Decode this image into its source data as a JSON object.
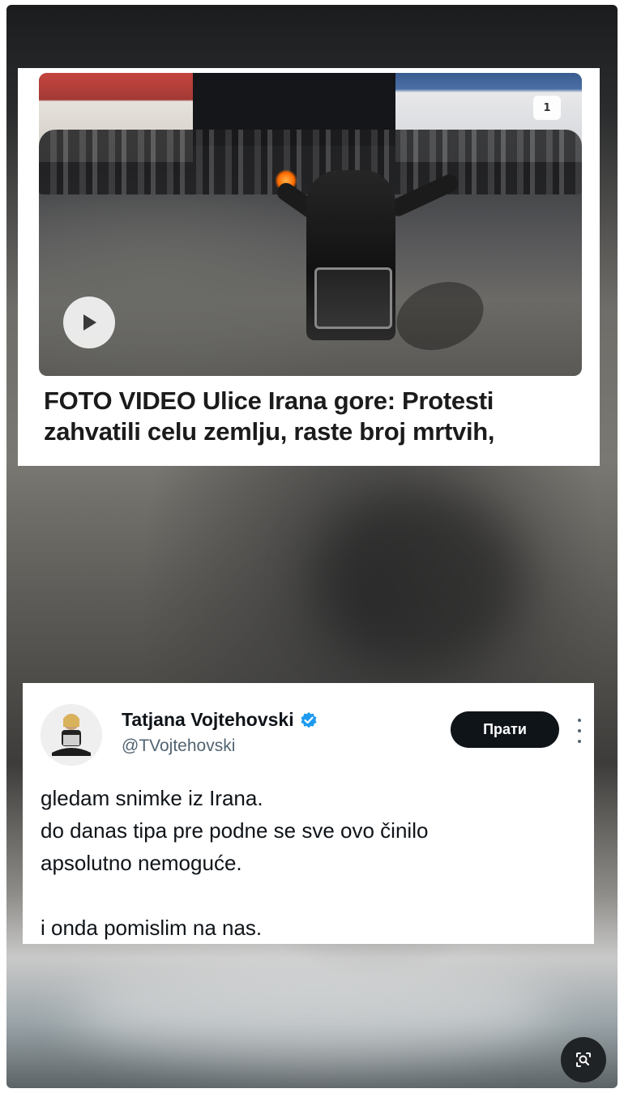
{
  "article": {
    "media_counter": "1",
    "headline_line1": "FOTO VIDEO Ulice Irana gore: Protesti",
    "headline_line2": "zahvatili celu zemlju, raste broj mrtvih,"
  },
  "tweet": {
    "display_name": "Tatjana Vojtehovski",
    "handle": "@TVojtehovski",
    "follow_label": "Прати",
    "text_lines": [
      "gledam snimke iz Irana.",
      "do danas tipa pre podne se sve ovo činilo",
      "apsolutno nemoguće.",
      "",
      "i onda pomislim na nas."
    ]
  },
  "icons": {
    "play": "play-icon",
    "verified": "verified-badge-icon",
    "more": "more-vertical-icon",
    "lens": "image-search-icon"
  },
  "colors": {
    "verified": "#1d9bf0",
    "follow_bg": "#0f1419",
    "handle": "#536471"
  }
}
